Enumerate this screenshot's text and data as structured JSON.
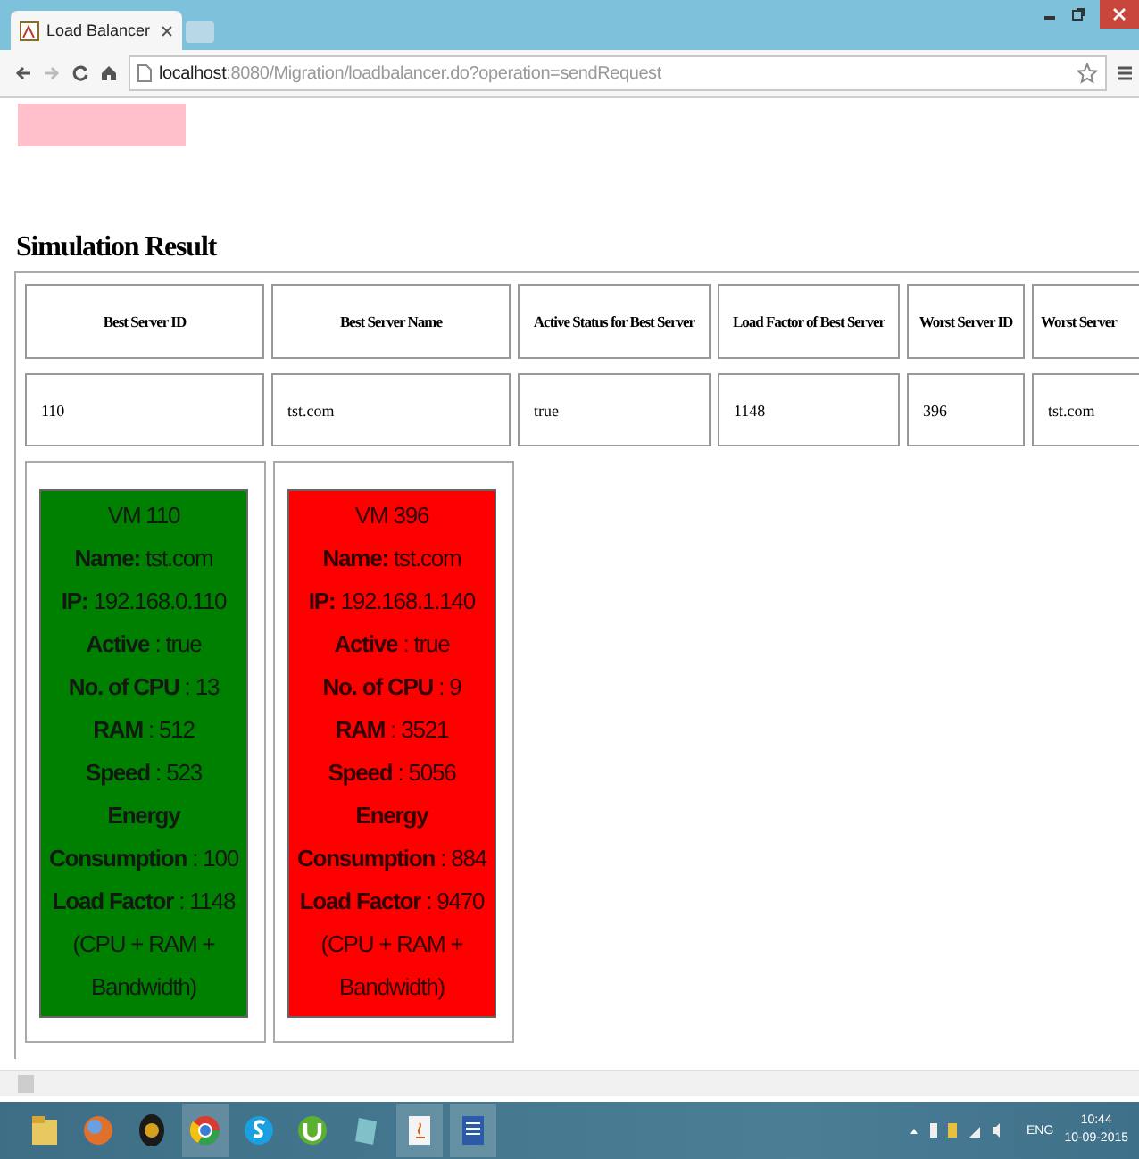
{
  "browser": {
    "tab_title": "Load Balancer",
    "url_host": "localhost",
    "url_path": ":8080/Migration/loadbalancer.do?operation=sendRequest"
  },
  "heading": "Simulation Result",
  "table": {
    "columns": [
      "Best Server ID",
      "Best Server Name",
      "Active Status for Best Server",
      "Load Factor of Best Server",
      "Worst Server ID",
      "Worst Server"
    ],
    "rows": [
      [
        "110",
        "tst.com",
        "true",
        "1148",
        "396",
        "tst.com"
      ]
    ]
  },
  "vms": [
    {
      "kind": "best",
      "color": "#008000",
      "lines": [
        "VM 110",
        "**Name:** tst.com",
        "**IP:** 192.168.0.110",
        "**Active** : true",
        "**No. of CPU** : 13",
        "**RAM** : 512",
        "**Speed** : 523",
        "**Energy Consumption** : 100",
        "**Load Factor** : 1148",
        "(CPU + RAM + Bandwidth)"
      ]
    },
    {
      "kind": "worst",
      "color": "#ff0000",
      "lines": [
        "VM 396",
        "**Name:** tst.com",
        "**IP:** 192.168.1.140",
        "**Active** : true",
        "**No. of CPU** : 9",
        "**RAM** : 3521",
        "**Speed** : 5056",
        "**Energy Consumption** : 884",
        "**Load Factor** : 9470",
        "(CPU + RAM + Bandwidth)"
      ]
    }
  ],
  "tray": {
    "language": "ENG",
    "time": "10:44",
    "date": "10-09-2015"
  }
}
